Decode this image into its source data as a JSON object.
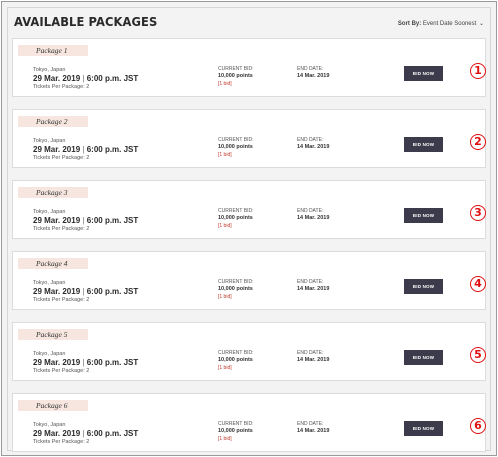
{
  "header": {
    "title": "AVAILABLE PACKAGES",
    "sort_label": "Sort By:",
    "sort_value": "Event Date Soonest"
  },
  "packages": [
    {
      "name": "Package 1",
      "location": "Tokyo, Japan",
      "date": "29 Mar. 2019",
      "time": "6:00 p.m. JST",
      "tickets": "Tickets Per Package: 2",
      "bid_label": "CURRENT BID:",
      "bid_value": "10,000 points",
      "bid_count": "[1 bid]",
      "end_label": "END DATE:",
      "end_value": "14 Mar. 2019",
      "button": "BID NOW",
      "marker": "1"
    },
    {
      "name": "Package 2",
      "location": "Tokyo, Japan",
      "date": "29 Mar. 2019",
      "time": "6:00 p.m. JST",
      "tickets": "Tickets Per Package: 2",
      "bid_label": "CURRENT BID:",
      "bid_value": "10,000 points",
      "bid_count": "[1 bid]",
      "end_label": "END DATE:",
      "end_value": "14 Mar. 2019",
      "button": "BID NOW",
      "marker": "2"
    },
    {
      "name": "Package 3",
      "location": "Tokyo, Japan",
      "date": "29 Mar. 2019",
      "time": "6:00 p.m. JST",
      "tickets": "Tickets Per Package: 2",
      "bid_label": "CURRENT BID:",
      "bid_value": "10,000 points",
      "bid_count": "[1 bid]",
      "end_label": "END DATE:",
      "end_value": "14 Mar. 2019",
      "button": "BID NOW",
      "marker": "3"
    },
    {
      "name": "Package 4",
      "location": "Tokyo, Japan",
      "date": "29 Mar. 2019",
      "time": "6:00 p.m. JST",
      "tickets": "Tickets Per Package: 2",
      "bid_label": "CURRENT BID:",
      "bid_value": "10,000 points",
      "bid_count": "[1 bid]",
      "end_label": "END DATE:",
      "end_value": "14 Mar. 2019",
      "button": "BID NOW",
      "marker": "4"
    },
    {
      "name": "Package 5",
      "location": "Tokyo, Japan",
      "date": "29 Mar. 2019",
      "time": "6:00 p.m. JST",
      "tickets": "Tickets Per Package: 2",
      "bid_label": "CURRENT BID:",
      "bid_value": "10,000 points",
      "bid_count": "[1 bid]",
      "end_label": "END DATE:",
      "end_value": "14 Mar. 2019",
      "button": "BID NOW",
      "marker": "5"
    },
    {
      "name": "Package 6",
      "location": "Tokyo, Japan",
      "date": "29 Mar. 2019",
      "time": "6:00 p.m. JST",
      "tickets": "Tickets Per Package: 2",
      "bid_label": "CURRENT BID:",
      "bid_value": "10,000 points",
      "bid_count": "[1 bid]",
      "end_label": "END DATE:",
      "end_value": "14 Mar. 2019",
      "button": "BID NOW",
      "marker": "6"
    }
  ],
  "colors": {
    "button_bg": "#3b3b4b",
    "marker": "#e01010",
    "package_tag_bg": "#f6e6df",
    "bid_count": "#c0392b"
  }
}
